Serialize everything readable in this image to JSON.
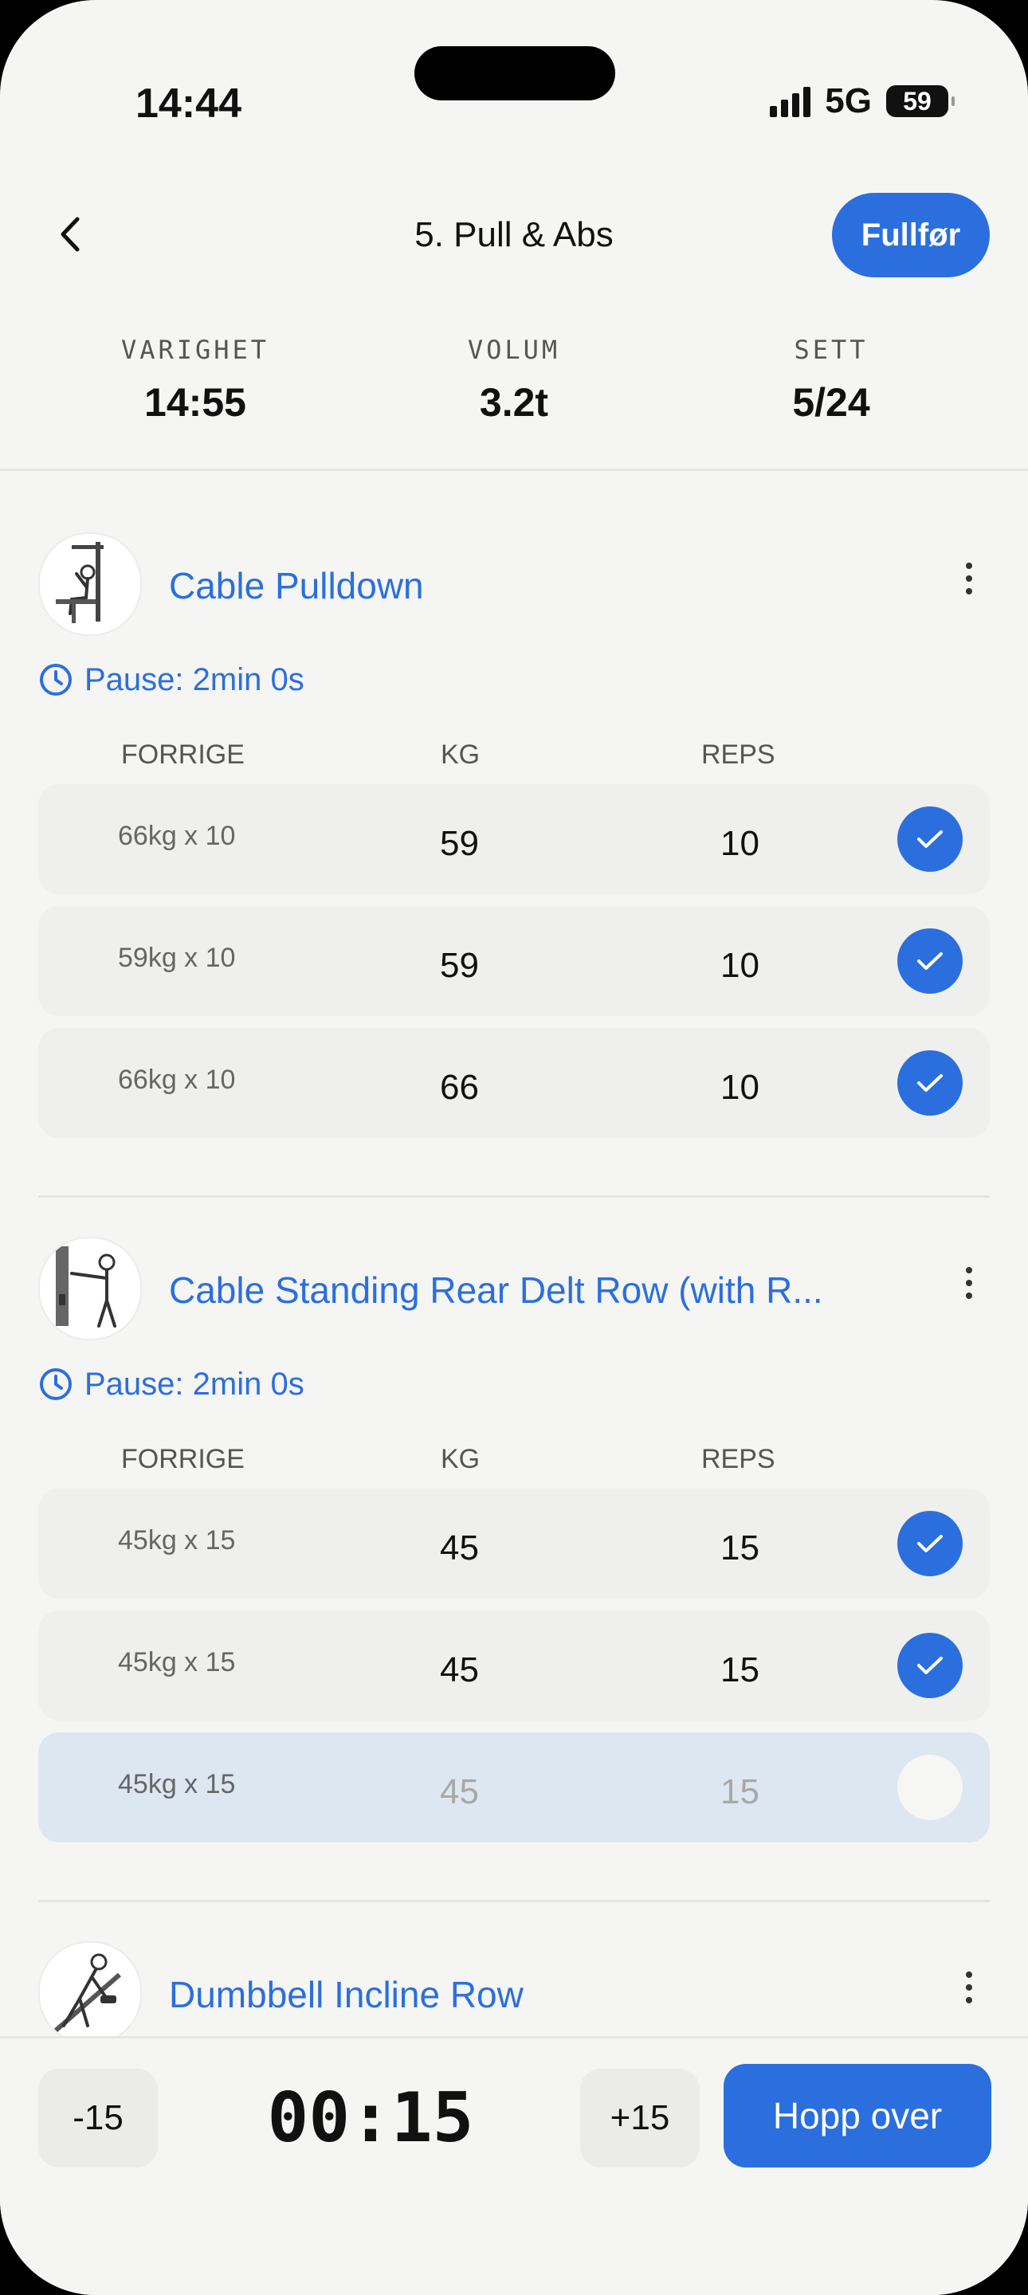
{
  "status_bar": {
    "time": "14:44",
    "network": "5G",
    "battery": "59"
  },
  "header": {
    "title": "5. Pull & Abs",
    "finish_label": "Fullfør"
  },
  "stats": [
    {
      "label": "VARIGHET",
      "value": "14:55"
    },
    {
      "label": "VOLUM",
      "value": "3.2t"
    },
    {
      "label": "SETT",
      "value": "5/24"
    }
  ],
  "columns": {
    "previous": "FORRIGE",
    "kg": "KG",
    "reps": "REPS"
  },
  "exercises": [
    {
      "name": "Cable Pulldown",
      "pause": "Pause: 2min 0s",
      "sets": [
        {
          "previous": "66kg x 10",
          "kg": "59",
          "reps": "10",
          "done": true
        },
        {
          "previous": "59kg x 10",
          "kg": "59",
          "reps": "10",
          "done": true
        },
        {
          "previous": "66kg x 10",
          "kg": "66",
          "reps": "10",
          "done": true
        }
      ]
    },
    {
      "name": "Cable Standing Rear Delt Row (with R...",
      "pause": "Pause: 2min 0s",
      "sets": [
        {
          "previous": "45kg x 15",
          "kg": "45",
          "reps": "15",
          "done": true
        },
        {
          "previous": "45kg x 15",
          "kg": "45",
          "reps": "15",
          "done": true
        },
        {
          "previous": "45kg x 15",
          "kg": "45",
          "reps": "15",
          "done": false
        }
      ]
    },
    {
      "name": "Dumbbell Incline Row"
    }
  ],
  "rest_timer": {
    "minus_label": "-15",
    "time": "00:15",
    "plus_label": "+15",
    "skip_label": "Hopp over"
  },
  "colors": {
    "accent": "#2b6fde",
    "background": "#f5f5f3",
    "active_row": "#dde7f2"
  }
}
